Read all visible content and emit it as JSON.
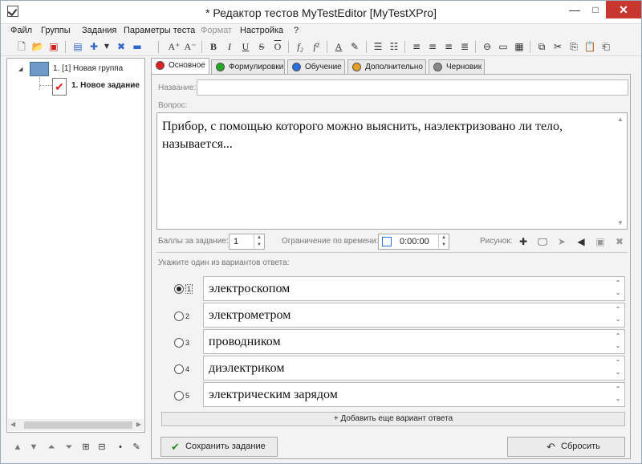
{
  "window": {
    "title": "* Редактор тестов MyTestEditor [MyTestXPro]",
    "minimize": "—",
    "maximize": "□",
    "close": "✕"
  },
  "menu": [
    "Файл",
    "Группы",
    "Задания",
    "Параметры теста",
    "Формат",
    "Настройка",
    "?"
  ],
  "tree": {
    "group_label": "1. [1] Новая группа",
    "task_label": "1. Новое задание",
    "expand_glyph": "◢"
  },
  "tabs": [
    {
      "label": "Основное",
      "color": "#e02020"
    },
    {
      "label": "Формулировки",
      "color": "#22aa22"
    },
    {
      "label": "Обучение",
      "color": "#2a6fe0"
    },
    {
      "label": "Дополнительно",
      "color": "#e8a020"
    },
    {
      "label": "Черновик",
      "color": "#888888"
    }
  ],
  "form": {
    "name_label": "Название:",
    "name_value": "",
    "question_label": "Вопрос:",
    "question_text": "Прибор, с помощью которого можно выяснить, наэлектризовано ли тело, называется...",
    "points_label": "Баллы за задание:",
    "points_value": "1",
    "time_label": "Ограничение по времени:",
    "time_value": "0:00:00",
    "picture_label": "Рисунок:",
    "answers_label": "Укажите один из вариантов ответа:"
  },
  "answers": [
    {
      "num": "1",
      "text": "электроскопом",
      "selected": true
    },
    {
      "num": "2",
      "text": "электрометром",
      "selected": false
    },
    {
      "num": "3",
      "text": "проводником",
      "selected": false
    },
    {
      "num": "4",
      "text": "диэлектриком",
      "selected": false
    },
    {
      "num": "5",
      "text": "электрическим зарядом",
      "selected": false
    }
  ],
  "buttons": {
    "add_answer": "Добавить еще вариант ответа",
    "add_answer_icon": "+",
    "save": "Сохранить задание",
    "reset": "Сбросить"
  },
  "toolbar_font_glyphs": {
    "font_grow": "A⁺",
    "font_shrink": "A⁻",
    "bold": "B",
    "italic": "I",
    "underline": "U",
    "strike": "S",
    "overline": "O",
    "subscript": "f₂",
    "superscript": "f²",
    "font_color": "A"
  }
}
